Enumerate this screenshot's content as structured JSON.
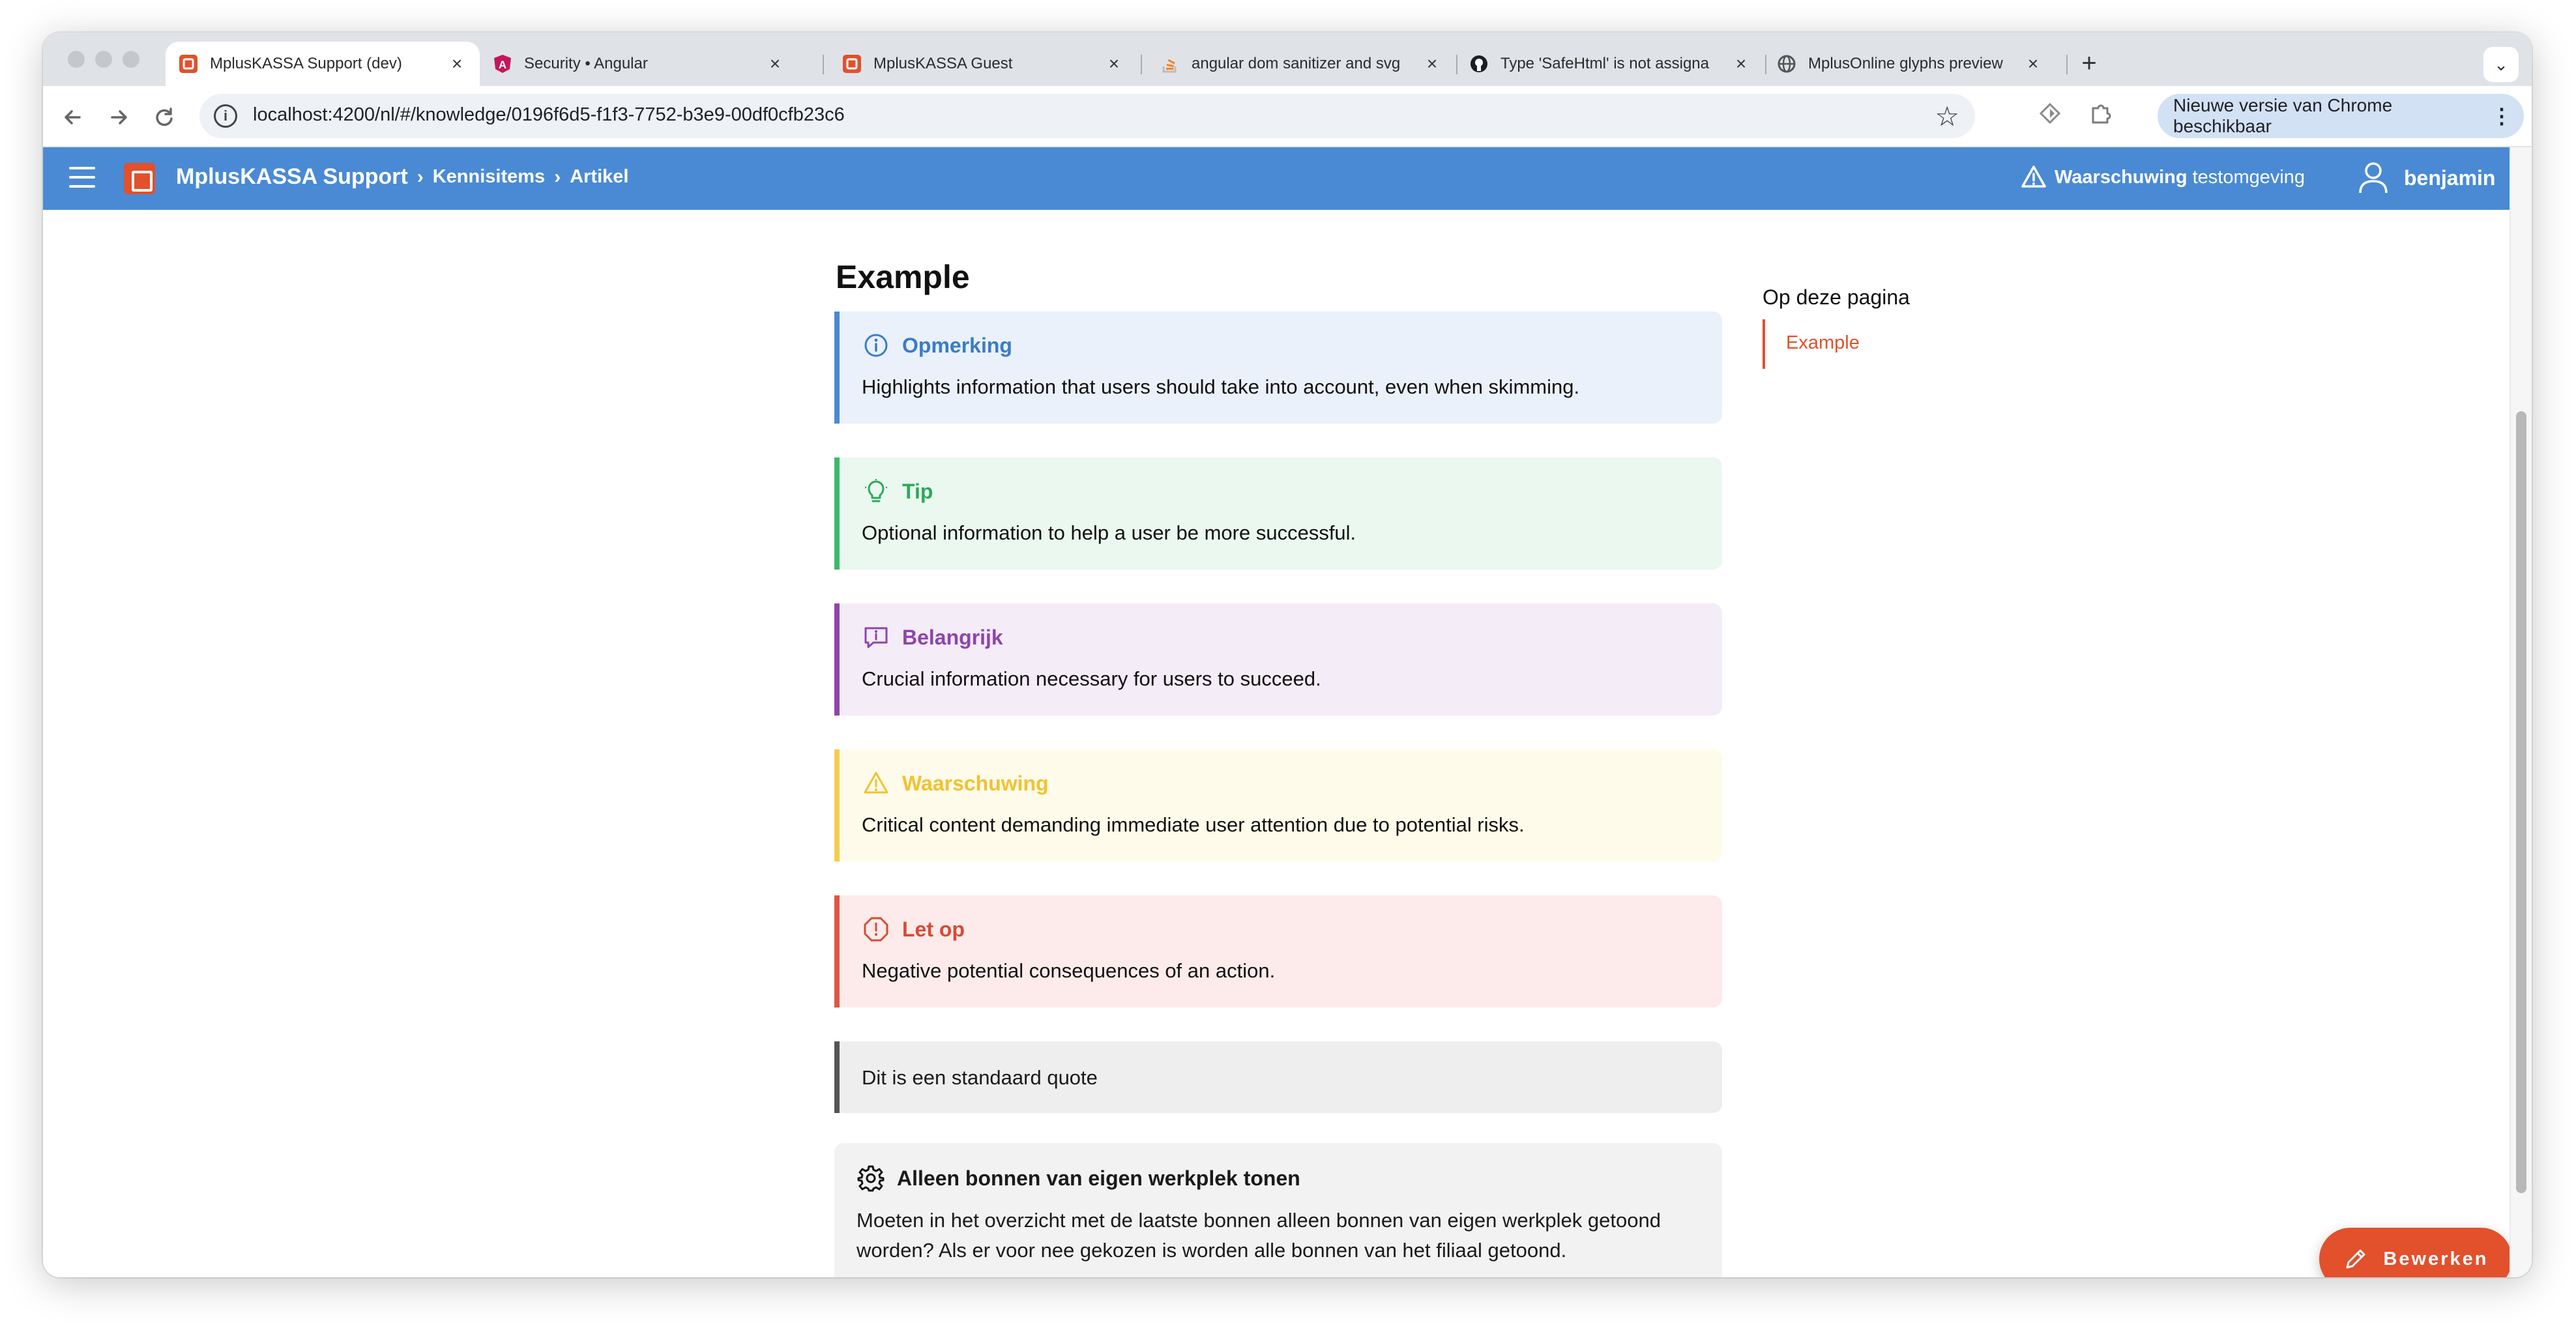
{
  "browser": {
    "tabs": [
      {
        "title": "MplusKASSA Support (dev)",
        "favicon": "mplus-icon",
        "active": true
      },
      {
        "title": "Security • Angular",
        "favicon": "angular-icon",
        "active": false
      },
      {
        "title": "MplusKASSA Guest",
        "favicon": "mplus-icon",
        "active": false
      },
      {
        "title": "angular dom sanitizer and svg",
        "favicon": "stackoverflow-icon",
        "active": false
      },
      {
        "title": "Type 'SafeHtml' is not assigna",
        "favicon": "github-icon",
        "active": false
      },
      {
        "title": "MplusOnline glyphs preview",
        "favicon": "globe-icon",
        "active": false
      }
    ],
    "close_glyph": "×",
    "new_tab_glyph": "+",
    "url": "localhost:4200/nl/#/knowledge/0196f6d5-f1f3-7752-b3e9-00df0cfb23c6",
    "update_text": "Nieuwe versie van Chrome beschikbaar"
  },
  "app": {
    "brand": "MplusKASSA Support",
    "breadcrumbs": [
      "Kennisitems",
      "Artikel"
    ],
    "warning_label": "Waarschuwing",
    "warning_sub": "testomgeving",
    "user_name": "benjamin"
  },
  "article": {
    "title": "Example",
    "callouts": [
      {
        "type": "note",
        "icon": "info-icon",
        "title": "Opmerking",
        "body": "Highlights information that users should take into account, even when skimming."
      },
      {
        "type": "tip",
        "icon": "lightbulb-icon",
        "title": "Tip",
        "body": "Optional information to help a user be more successful."
      },
      {
        "type": "important",
        "icon": "message-alert-icon",
        "title": "Belangrijk",
        "body": "Crucial information necessary for users to succeed."
      },
      {
        "type": "warning",
        "icon": "warning-triangle-icon",
        "title": "Waarschuwing",
        "body": "Critical content demanding immediate user attention due to potential risks."
      },
      {
        "type": "caution",
        "icon": "octagon-alert-icon",
        "title": "Let op",
        "body": "Negative potential consequences of an action."
      }
    ],
    "quote": "Dit is een standaard quote",
    "setting": {
      "icon": "gear-icon",
      "title": "Alleen bonnen van eigen werkplek tonen",
      "body": "Moeten in het overzicht met de laatste bonnen alleen bonnen van eigen werkplek getoond worden? Als er voor nee gekozen is worden alle bonnen van het filiaal getoond."
    }
  },
  "toc": {
    "title": "Op deze pagina",
    "items": [
      "Example"
    ]
  },
  "edit_button": {
    "label": "Bewerken"
  },
  "colors": {
    "header": "#4a8ad4",
    "brand_accent": "#e2502c",
    "note": "#4a8ad4",
    "tip": "#3db96a",
    "important": "#8e44ad",
    "warning": "#f5cc50",
    "caution": "#e05543"
  }
}
